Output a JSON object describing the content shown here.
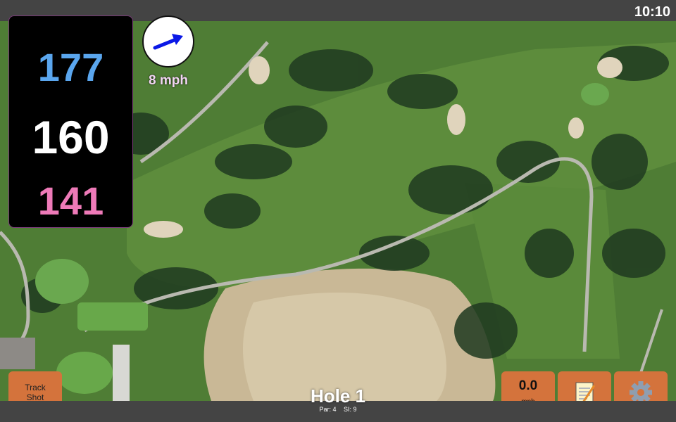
{
  "status": {
    "time": "10:10"
  },
  "yardages": {
    "back": "177",
    "middle": "160",
    "front": "141"
  },
  "wind": {
    "speed": "8 mph",
    "icon": "wind-arrow-icon"
  },
  "hole": {
    "title": "Hole 1",
    "par": "Par: 4",
    "si": "SI: 9"
  },
  "buttons": {
    "track_shot_line1": "Track",
    "track_shot_line2": "Shot",
    "speed_value": "0.0",
    "speed_unit": "mph",
    "notes_icon": "notepad-icon",
    "settings_icon": "gear-icon"
  },
  "colors": {
    "button": "#d4733c",
    "back_yardage": "#5aa6ee",
    "middle_yardage": "#ffffff",
    "front_yardage": "#ee7ab8"
  }
}
